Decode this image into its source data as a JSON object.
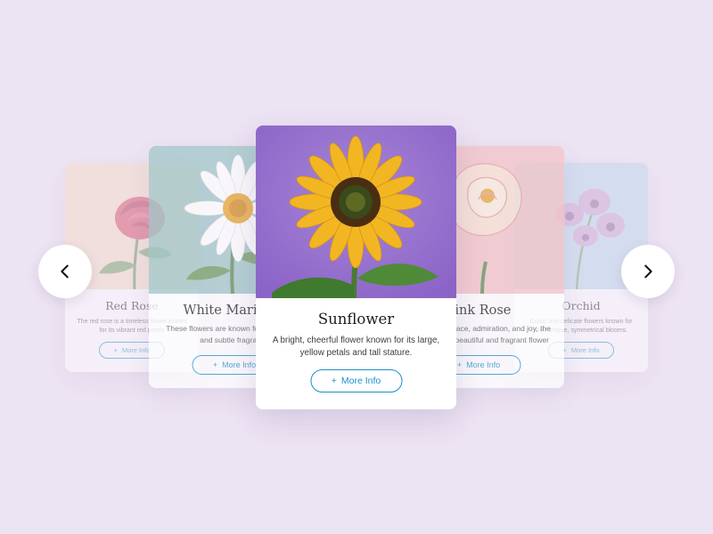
{
  "carousel": {
    "prev_icon": "chevron-left-icon",
    "next_icon": "chevron-right-icon",
    "accent_color": "#1a90c8",
    "background_color": "#ece3f3",
    "cards": [
      {
        "title": "Red Rose",
        "description": "The red rose is a timeless flower known for its vibrant red petals",
        "button_label": "More Info",
        "button_icon": "plus-icon"
      },
      {
        "title": "White Marigold",
        "description": "These flowers are known for their beauty and subtle fragrance",
        "button_label": "More Info",
        "button_icon": "plus-icon"
      },
      {
        "title": "Sunflower",
        "description": "A bright, cheerful flower known for its large, yellow petals and tall stature.",
        "button_label": "More Info",
        "button_icon": "plus-icon"
      },
      {
        "title": "Pink Rose",
        "description": "Symbolizing grace, admiration, and joy, the pink rose is a beautiful and fragrant flower",
        "button_label": "More Info",
        "button_icon": "plus-icon"
      },
      {
        "title": "Orchid",
        "description": "Exotic and delicate flowers known for their unique, symmetrical blooms.",
        "button_label": "More Info",
        "button_icon": "plus-icon"
      }
    ]
  }
}
